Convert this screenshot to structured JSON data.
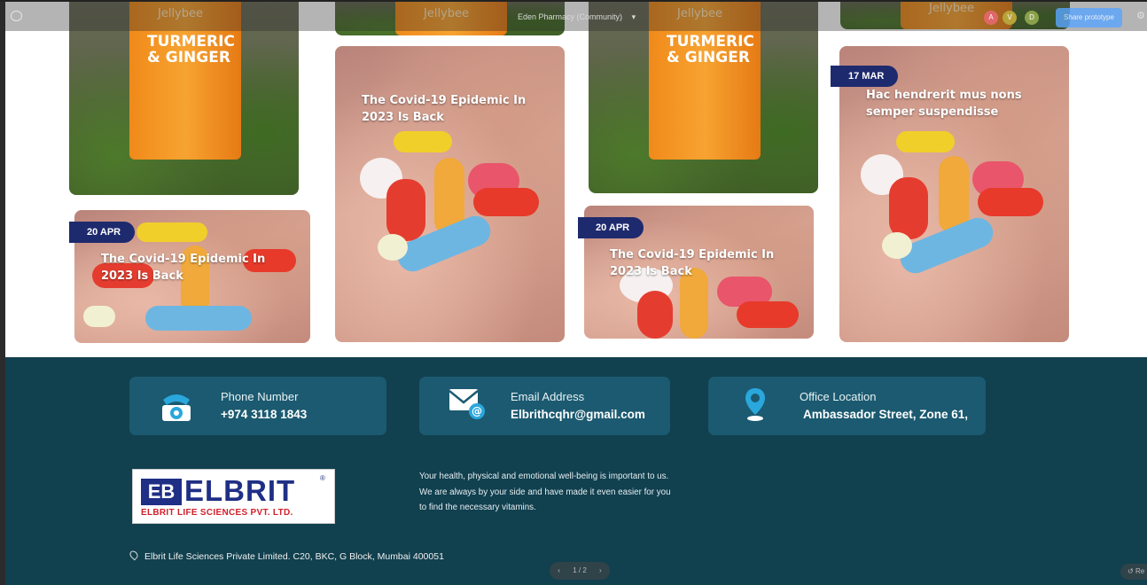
{
  "toolbar": {
    "title": "Eden Pharmacy (Community)",
    "chevron": "▾",
    "avatars": [
      "A",
      "V",
      "D"
    ],
    "share_label": "Share prototype",
    "settings_icon": "sliders-icon"
  },
  "products": {
    "brand": "Jellybee",
    "name_line1": "TURMERIC",
    "name_line2": "& GINGER"
  },
  "blog_cards": [
    {
      "date": "20 APR",
      "title": "The Covid-19 Epidemic In 2023 Is Back"
    },
    {
      "date": "",
      "title": "The Covid-19 Epidemic In 2023 Is Back"
    },
    {
      "date": "20 APR",
      "title": "The Covid-19 Epidemic In 2023 Is Back"
    },
    {
      "date": "17 MAR",
      "title": "Hac hendrerit mus nons semper suspendisse"
    }
  ],
  "contacts": [
    {
      "label": "Phone Number",
      "value": "+974 3118 1843",
      "icon": "telephone-icon"
    },
    {
      "label": "Email Address",
      "value": "Elbrithcqhr@gmail.com",
      "icon": "email-icon"
    },
    {
      "label": "Office Location",
      "value": "Ambassador Street, Zone 61,",
      "icon": "location-pin-icon"
    }
  ],
  "logo": {
    "mark": "EB",
    "word": "ELBRIT",
    "reg": "®",
    "subtitle": "ELBRIT LIFE SCIENCES PVT. LTD."
  },
  "tagline": "Your health, physical and emotional well-being is important to us. We are always by your side and have made it even easier for you to find the necessary vitamins.",
  "footer_address": "Elbrit Life Sciences Private Limited. C20, BKC, G Block, Mumbai 400051",
  "pager": {
    "prev": "‹",
    "label": "1 / 2",
    "next": "›"
  },
  "restart_label": "Re"
}
